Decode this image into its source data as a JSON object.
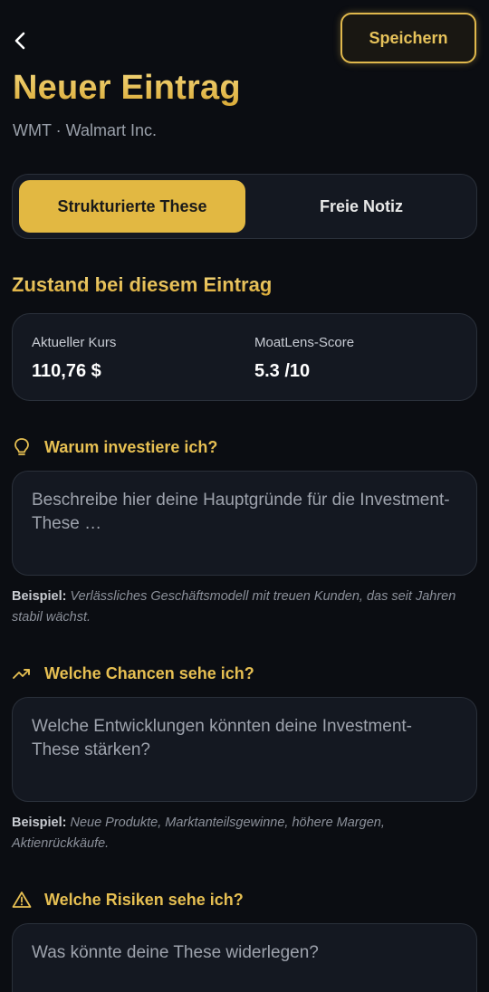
{
  "header": {
    "save_label": "Speichern",
    "title": "Neuer Eintrag",
    "subtitle": "WMT · Walmart Inc."
  },
  "segmented": {
    "options": [
      "Strukturierte These",
      "Freie Notiz"
    ],
    "selected": "Strukturierte These"
  },
  "state_section": {
    "title": "Zustand bei diesem Eintrag",
    "metrics": [
      {
        "label": "Aktueller Kurs",
        "value": "110,76 $"
      },
      {
        "label": "MoatLens-Score",
        "value": "5.3 /10"
      }
    ]
  },
  "questions": [
    {
      "icon": "lightbulb-icon",
      "label": "Warum investiere ich?",
      "placeholder": "Beschreibe hier deine Hauptgründe für die Investment-These …",
      "example_prefix": "Beispiel:",
      "example_text": "Verlässliches Geschäftsmodell mit treuen Kunden, das seit Jahren stabil wächst."
    },
    {
      "icon": "trending-up-icon",
      "label": "Welche Chancen sehe ich?",
      "placeholder": "Welche Entwicklungen könnten deine Investment-These stärken?",
      "example_prefix": "Beispiel:",
      "example_text": "Neue Produkte, Marktanteilsgewinne, höhere Margen, Aktienrückkäufe."
    },
    {
      "icon": "warning-triangle-icon",
      "label": "Welche Risiken sehe ich?",
      "placeholder": "Was könnte deine These widerlegen?"
    }
  ],
  "colors": {
    "background": "#0b0d12",
    "accent_gold": "#e2b842",
    "card": "#141821",
    "border": "#2a303a"
  }
}
